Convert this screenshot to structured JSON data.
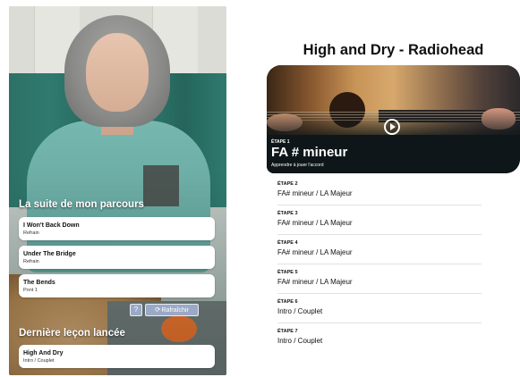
{
  "left_screen": {
    "continue_section": {
      "title": "La suite de mon parcours",
      "items": [
        {
          "title": "I Won't Back Down",
          "subtitle": "Refrain"
        },
        {
          "title": "Under The Bridge",
          "subtitle": "Refrain"
        },
        {
          "title": "The Bends",
          "subtitle": "Pont 1"
        }
      ]
    },
    "help_button": {
      "label": "?"
    },
    "refresh_button": {
      "icon": "refresh-icon",
      "glyph": "⟳",
      "label": "Rafraîchir"
    },
    "last_lesson_section": {
      "title": "Dernière leçon lancée",
      "item": {
        "title": "High And Dry",
        "subtitle": "Intro / Couplet"
      }
    }
  },
  "right_screen": {
    "song_title": "High and Dry - Radiohead",
    "current_step": {
      "step_label": "ÉTAPE 1",
      "chord": "FA # mineur",
      "description": "Apprendre à jouer l'accord",
      "play_icon": "play-icon"
    },
    "steps": [
      {
        "label": "ÉTAPE 2",
        "value": "FA# mineur / LA Majeur"
      },
      {
        "label": "ÉTAPE 3",
        "value": "FA# mineur / LA Majeur"
      },
      {
        "label": "ÉTAPE 4",
        "value": "FA# mineur / LA Majeur"
      },
      {
        "label": "ÉTAPE 5",
        "value": "FA# mineur / LA Majeur"
      },
      {
        "label": "ÉTAPE 6",
        "value": "Intro / Couplet"
      },
      {
        "label": "ÉTAPE 7",
        "value": "Intro / Couplet"
      }
    ]
  },
  "colors": {
    "teal_chair": "#2f7a6f",
    "sweater": "#6fb0a8",
    "hero_dark": "#0e1619",
    "button_blue": "#a0afcd"
  }
}
